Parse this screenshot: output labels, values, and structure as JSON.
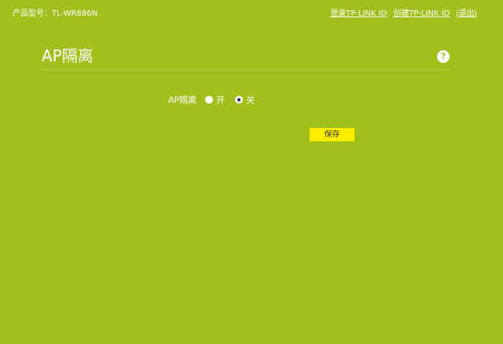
{
  "header": {
    "model_label": "产品型号：TL-WR886N",
    "links": {
      "login": "登录TP-LINK ID",
      "create": "创建TP-LINK ID",
      "logout": "|退出|"
    }
  },
  "page": {
    "title": "AP隔离",
    "help_icon": "?"
  },
  "setting": {
    "label": "AP隔离",
    "options": [
      {
        "label": "开",
        "checked": false
      },
      {
        "label": "关",
        "checked": true
      }
    ]
  },
  "actions": {
    "save_label": "保存"
  },
  "colors": {
    "background": "#a1c01e",
    "save_button": "#ffed00",
    "text": "#ffffff"
  }
}
